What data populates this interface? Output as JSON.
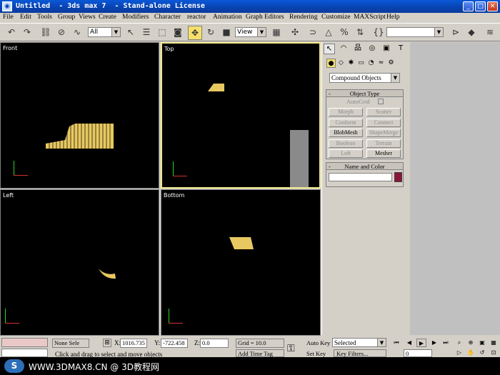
{
  "window": {
    "title": "Untitled  - 3ds max 7  - Stand-alone License",
    "icon": "3ds-max-icon"
  },
  "menu": [
    "File",
    "Edit",
    "Tools",
    "Group",
    "Views",
    "Create",
    "Modifiers",
    "Character",
    "reactor",
    "Animation",
    "Graph Editors",
    "Rendering",
    "Customize",
    "MAXScript",
    "Help"
  ],
  "toolbar": {
    "selection_filter": "All",
    "coordinate_system": "View"
  },
  "viewports": {
    "front": "Front",
    "top": "Top",
    "left": "Left",
    "bottom": "Bottom"
  },
  "command_panel": {
    "category": "Compound Objects",
    "object_type": {
      "title": "Object Type",
      "autogrid": "AutoGrid",
      "buttons": [
        {
          "label": "Morph",
          "enabled": false
        },
        {
          "label": "Scatter",
          "enabled": false
        },
        {
          "label": "Conform",
          "enabled": false
        },
        {
          "label": "Connect",
          "enabled": false
        },
        {
          "label": "BlobMesh",
          "enabled": true
        },
        {
          "label": "ShapeMerge",
          "enabled": false
        },
        {
          "label": "Boolean",
          "enabled": false
        },
        {
          "label": "Terrain",
          "enabled": false
        },
        {
          "label": "Loft",
          "enabled": false
        },
        {
          "label": "Mesher",
          "enabled": true
        }
      ]
    },
    "name_and_color": {
      "title": "Name and Color",
      "swatch_color": "#8b1538"
    }
  },
  "status": {
    "selection": "None Sele",
    "x_label": "X:",
    "x_value": "1016.735",
    "y_label": "Y:",
    "y_value": "-722.458",
    "z_label": "Z:",
    "z_value": "0.0",
    "grid": "Grid = 10.0",
    "prompt": "Click and drag to select and move objects",
    "add_time_tag": "Add Time Tag",
    "auto_key": "Auto Key",
    "set_key": "Set Key",
    "key_mode": "Selected",
    "key_filters": "Key Filters...",
    "frame": "0"
  },
  "watermark": {
    "text": "WWW.3DMAX8.CN @ 3D教程网"
  },
  "colors": {
    "accent": "#f6e06a",
    "object_yellow": "#e8c860",
    "viewport_bg": "#000000"
  }
}
